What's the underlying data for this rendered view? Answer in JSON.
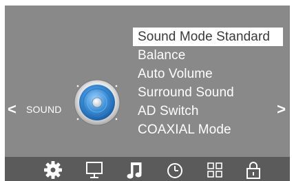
{
  "section": {
    "label": "SOUND",
    "prev_arrow": "<",
    "next_arrow": ">"
  },
  "menu": {
    "items": [
      {
        "label": "Sound Mode Standard",
        "selected": true
      },
      {
        "label": "Balance",
        "selected": false
      },
      {
        "label": "Auto Volume",
        "selected": false
      },
      {
        "label": "Surround Sound",
        "selected": false
      },
      {
        "label": "AD Switch",
        "selected": false
      },
      {
        "label": "COAXIAL Mode",
        "selected": false
      }
    ]
  },
  "bottom_bar": {
    "tabs": [
      {
        "icon": "gear-icon",
        "active": false
      },
      {
        "icon": "monitor-icon",
        "active": false
      },
      {
        "icon": "music-note-icon",
        "active": true
      },
      {
        "icon": "clock-icon",
        "active": false
      },
      {
        "icon": "grid-icon",
        "active": false
      },
      {
        "icon": "lock-icon",
        "active": false
      }
    ]
  },
  "colors": {
    "background": "#898989",
    "bar": "#5b5b5b",
    "text": "#ffffff",
    "selected_bg": "#ffffff",
    "selected_text": "#3a3a3a",
    "speaker_blue": "#3d8fd6"
  }
}
